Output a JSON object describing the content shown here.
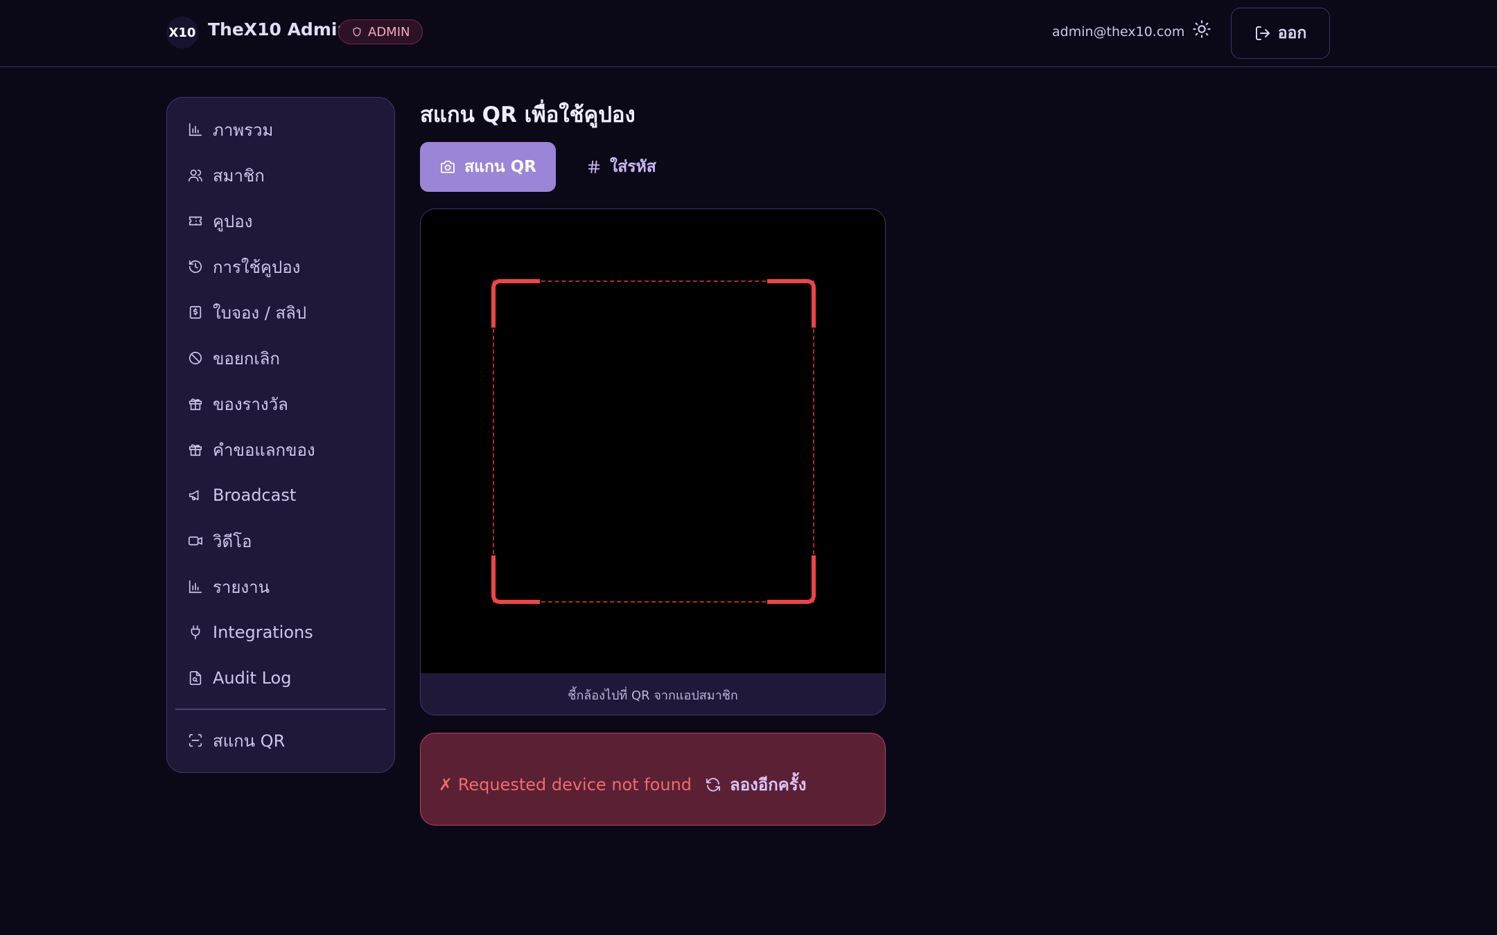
{
  "header": {
    "logo_text": "X10",
    "app_title": "TheX10 Admin",
    "role_badge": "ADMIN",
    "user_email": "admin@thex10.com",
    "logout_label": "ออก"
  },
  "sidebar": {
    "items": [
      {
        "label": "ภาพรวม",
        "icon": "bar-chart-icon"
      },
      {
        "label": "สมาชิก",
        "icon": "users-icon"
      },
      {
        "label": "คูปอง",
        "icon": "ticket-icon"
      },
      {
        "label": "การใช้คูปอง",
        "icon": "history-icon"
      },
      {
        "label": "ใบจอง / สลิป",
        "icon": "receipt-dollar-icon"
      },
      {
        "label": "ขอยกเลิก",
        "icon": "ban-icon"
      },
      {
        "label": "ของรางวัล",
        "icon": "gift-icon"
      },
      {
        "label": "คำขอแลกของ",
        "icon": "gift-icon"
      },
      {
        "label": "Broadcast",
        "icon": "megaphone-icon"
      },
      {
        "label": "วิดีโอ",
        "icon": "video-icon"
      },
      {
        "label": "รายงาน",
        "icon": "bar-chart-icon"
      },
      {
        "label": "Integrations",
        "icon": "plug-icon"
      },
      {
        "label": "Audit Log",
        "icon": "file-search-icon"
      }
    ],
    "scan_item": {
      "label": "สแกน QR",
      "icon": "scan-icon"
    }
  },
  "main": {
    "title": "สแกน QR เพื่อใช้คูปอง",
    "tabs": [
      {
        "label": "สแกน QR",
        "icon": "camera-icon",
        "active": true
      },
      {
        "label": "ใส่รหัส",
        "icon": "hash-icon",
        "active": false
      }
    ],
    "scanner_caption": "ชี้กล้องไปที่ QR จากแอปสมาชิก",
    "error_message": "✗ Requested device not found",
    "retry_label": "ลองอีกครั้ง"
  },
  "colors": {
    "background": "#0b0918",
    "panel": "#1f1838",
    "accent": "#9b85d6",
    "scan_frame": "#ef4444",
    "error_bg": "#5b2034"
  }
}
